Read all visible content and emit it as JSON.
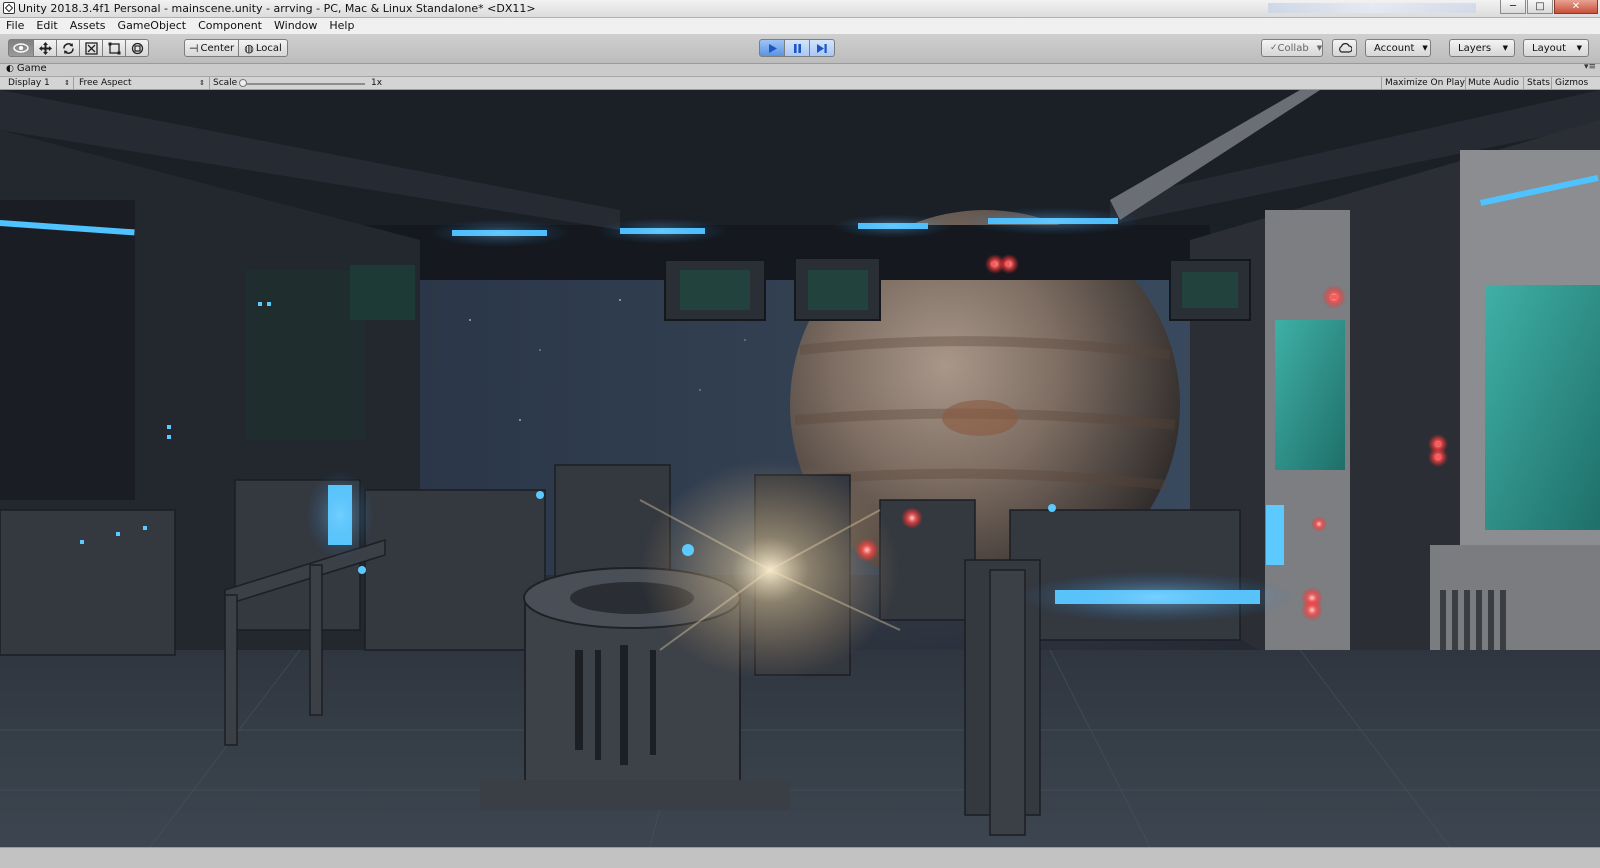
{
  "window": {
    "title": "Unity 2018.3.4f1 Personal - mainscene.unity - arrving - PC, Mac & Linux Standalone* <DX11>",
    "controls": {
      "minimize": "─",
      "maximize": "□",
      "close": "✕"
    }
  },
  "menubar": {
    "items": [
      "File",
      "Edit",
      "Assets",
      "GameObject",
      "Component",
      "Window",
      "Help"
    ]
  },
  "toolbar": {
    "pivot": "Center",
    "space": "Local",
    "collab": "Collab",
    "account": "Account",
    "layers": "Layers",
    "layout": "Layout",
    "tools": [
      "view-hand-icon",
      "move-icon",
      "rotate-icon",
      "scale-icon",
      "rect-icon",
      "transform-icon"
    ],
    "play_state": "playing"
  },
  "game_view": {
    "tab_label": "Game",
    "display": "Display 1",
    "aspect": "Free Aspect",
    "scale_label": "Scale",
    "scale_value": "1x",
    "toggles": [
      "Maximize On Play",
      "Mute Audio",
      "Stats",
      "Gizmos"
    ]
  },
  "colors": {
    "neon_blue": "#3fb4ff",
    "warning_red": "#ff4d4d",
    "screen_teal": "#2f9c94"
  }
}
